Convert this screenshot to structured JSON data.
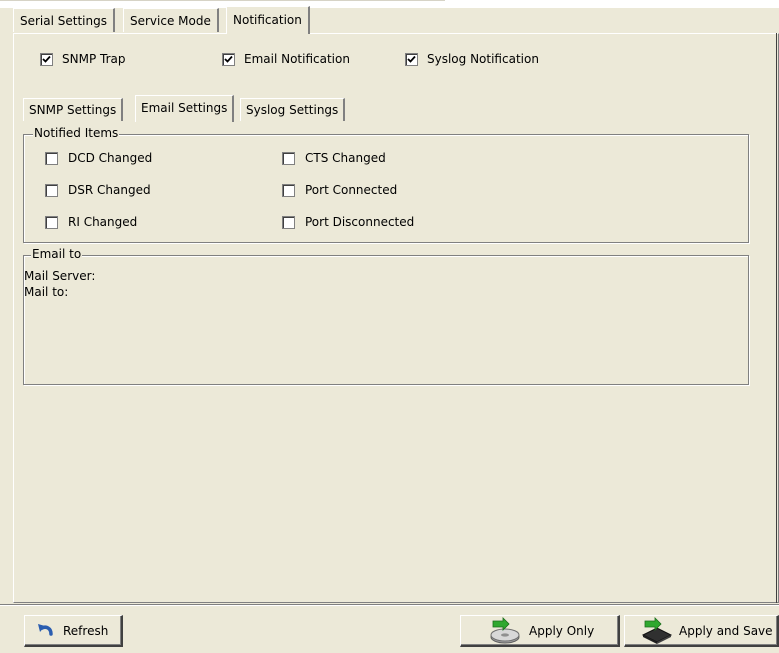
{
  "top_tabs": [
    {
      "label": "Serial Settings",
      "active": false
    },
    {
      "label": "Service Mode",
      "active": false
    },
    {
      "label": "Notification",
      "active": true
    }
  ],
  "notification_options": [
    {
      "label": "SNMP Trap",
      "checked": true
    },
    {
      "label": "Email Notification",
      "checked": true
    },
    {
      "label": "Syslog Notification",
      "checked": true
    }
  ],
  "inner_tabs": [
    {
      "label": "SNMP Settings",
      "active": false
    },
    {
      "label": "Email Settings",
      "active": true
    },
    {
      "label": "Syslog Settings",
      "active": false
    }
  ],
  "notified_items": {
    "legend": "Notified Items",
    "items": [
      {
        "label": "DCD Changed",
        "checked": false
      },
      {
        "label": "CTS Changed",
        "checked": false
      },
      {
        "label": "DSR Changed",
        "checked": false
      },
      {
        "label": "Port Connected",
        "checked": false
      },
      {
        "label": "RI Changed",
        "checked": false
      },
      {
        "label": "Port Disconnected",
        "checked": false
      }
    ]
  },
  "email_to": {
    "legend": "Email to",
    "mail_server_label": "Mail Server:",
    "mail_to_label": "Mail to:"
  },
  "buttons": {
    "refresh": "Refresh",
    "apply_only": "Apply Only",
    "apply_and_save": "Apply and Save"
  },
  "colors": {
    "background": "#ece9d8",
    "refresh_icon": "#2a5db0",
    "apply_icon_green": "#2fa82f"
  },
  "icons": {
    "refresh": "refresh-arrow-icon",
    "apply_only": "disk-arrow-icon",
    "apply_and_save": "chip-arrow-icon"
  }
}
